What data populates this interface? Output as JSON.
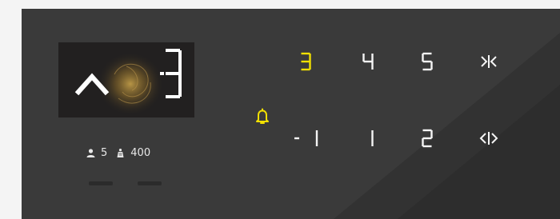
{
  "display": {
    "direction": "up",
    "floor": "3"
  },
  "stats": {
    "persons": "5",
    "load": "400",
    "person_icon": "person-icon",
    "load_icon": "weight-icon"
  },
  "alarm": {
    "icon": "bell-icon",
    "color": "#f2e000"
  },
  "keys": [
    {
      "id": "3",
      "label": "3",
      "active": true
    },
    {
      "id": "4",
      "label": "4",
      "active": false
    },
    {
      "id": "5",
      "label": "5",
      "active": false
    },
    {
      "id": "close",
      "label": ">|<",
      "icon": "door-close-icon",
      "active": false
    },
    {
      "id": "-1",
      "label": "-1",
      "active": false
    },
    {
      "id": "1",
      "label": "1",
      "active": false
    },
    {
      "id": "2",
      "label": "2",
      "active": false
    },
    {
      "id": "open",
      "label": "<|>",
      "icon": "door-open-icon",
      "active": false
    }
  ],
  "colors": {
    "panel": "#3a3a3a",
    "key_default": "#f5f5f5",
    "key_active": "#f2e000"
  }
}
